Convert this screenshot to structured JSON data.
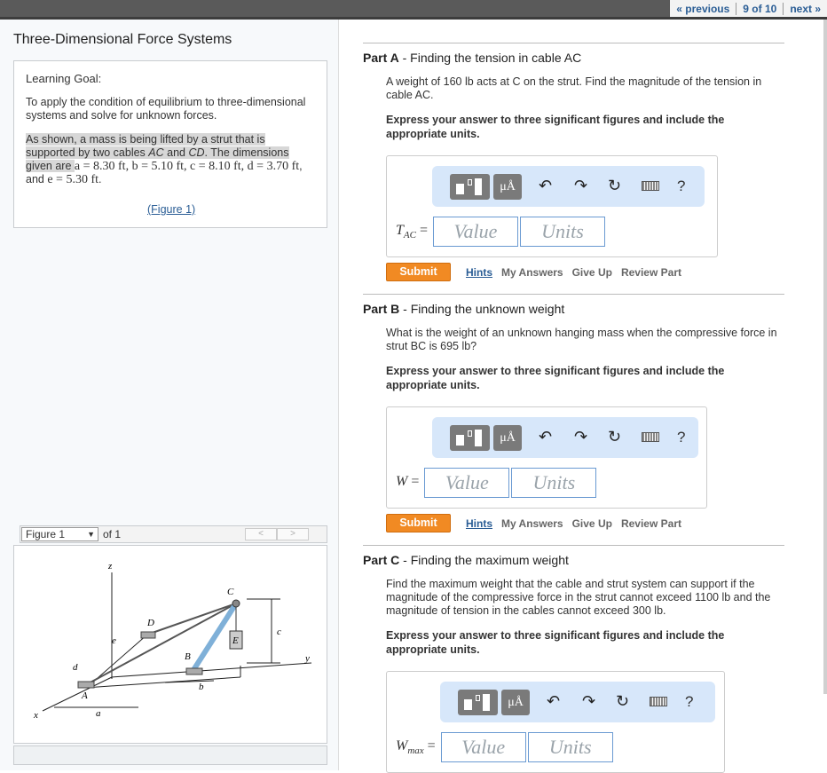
{
  "nav": {
    "previous": "« previous",
    "position": "9 of 10",
    "next": "next »"
  },
  "assignment": {
    "title": "Three-Dimensional Force Systems",
    "goal_heading": "Learning Goal:",
    "goal_text": "To apply the condition of equilibrium to three-dimensional systems and solve for unknown forces.",
    "intro_a": "As shown, a mass is being lifted by a strut that is supported by two cables ",
    "intro_ac": "AC",
    "intro_and": " and ",
    "intro_cd": "CD",
    "intro_b": ". The dimensions given are ",
    "dims": "a = 8.30 ft, b = 5.10 ft, c = 8.10 ft, d = 3.70 ft",
    "dims_and": ", and ",
    "dims_e": "e = 5.30 ft",
    "dims_end": ".",
    "figure_link": "(Figure 1)"
  },
  "figure": {
    "select_value": "Figure 1",
    "of_label": "of 1",
    "prev_arrow": "<",
    "next_arrow": ">",
    "labels": {
      "z": "z",
      "c_top": "C",
      "d": "D",
      "e": "e",
      "b_lbl": "B",
      "e_box": "E",
      "c_dim": "c",
      "y": "y",
      "d_dim": "d",
      "a_pt": "A",
      "b_dim": "b",
      "x": "x",
      "a_dim": "a"
    }
  },
  "parts": [
    {
      "letter": "Part A",
      "title": "Finding the tension in cable AC",
      "question": "A weight of 160 lb acts at C on the strut. Find the magnitude of the tension in cable AC.",
      "instruction": "Express your answer to three significant figures and include the appropriate units.",
      "answer_label": "T",
      "answer_sub": "AC",
      "value_placeholder": "Value",
      "units_placeholder": "Units"
    },
    {
      "letter": "Part B",
      "title": "Finding the unknown weight",
      "question": "What is the weight of an unknown hanging mass when the compressive force in strut BC is 695 lb?",
      "instruction": "Express your answer to three significant figures and include the appropriate units.",
      "answer_label": "W",
      "answer_sub": "",
      "value_placeholder": "Value",
      "units_placeholder": "Units"
    },
    {
      "letter": "Part C",
      "title": "Finding the maximum weight",
      "question": "Find the maximum weight that the cable and strut system can support if the magnitude of the compressive force in the strut cannot exceed 1100 lb and the magnitude of tension in the cables cannot exceed 300 lb.",
      "instruction": "Express your answer to three significant figures and include the appropriate units.",
      "answer_label": "W",
      "answer_sub": "max",
      "value_placeholder": "Value",
      "units_placeholder": "Units"
    }
  ],
  "toolbar": {
    "greek": "μÅ",
    "undo": "↶",
    "redo": "↷",
    "reset": "↻",
    "help": "?"
  },
  "actions": {
    "submit": "Submit",
    "hints": "Hints",
    "my_answers": "My Answers",
    "give_up": "Give Up",
    "review": "Review Part"
  },
  "equals": "="
}
